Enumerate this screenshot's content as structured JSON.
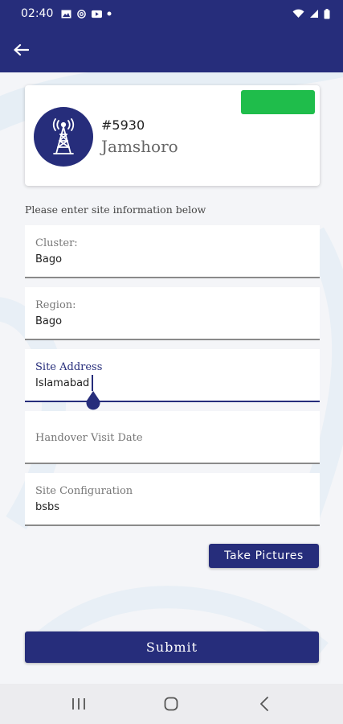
{
  "status_bar": {
    "time": "02:40",
    "left_icons": [
      "image-icon",
      "at-sign-icon",
      "youtube-icon",
      "dot-icon"
    ],
    "right_icons": [
      "wifi-icon",
      "signal-icon",
      "battery-icon"
    ]
  },
  "app_bar": {
    "back_icon": "arrow-left-icon",
    "color": "#262d7b"
  },
  "site": {
    "id": "#5930",
    "name": "Jamshoro",
    "avatar_icon": "tower-icon",
    "status_color": "#1fbd4b"
  },
  "form": {
    "instructions": "Please enter site information below",
    "fields": [
      {
        "label": "Cluster:",
        "value": "Bago"
      },
      {
        "label": "Region:",
        "value": "Bago"
      },
      {
        "label": "Site Address",
        "value": "Islamabad"
      },
      {
        "label": "Handover Visit Date",
        "value": ""
      },
      {
        "label": "Site Configuration",
        "value": "bsbs"
      }
    ],
    "take_pictures_label": "Take Pictures",
    "submit_label": "Submit"
  },
  "nav": {
    "icons": [
      "recent-apps-icon",
      "home-icon",
      "back-nav-icon"
    ]
  }
}
